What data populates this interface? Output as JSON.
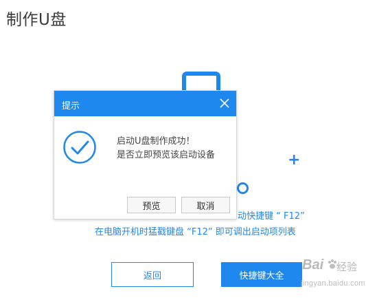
{
  "page": {
    "title": "制作U盘"
  },
  "background": {
    "hint_line1": "动快捷键 “ F12”",
    "hint_line2": "在电脑开机时猛戳键盘 “F12” 即可调出启动项列表",
    "back_label": "返回",
    "shortcut_label": "快捷键大全"
  },
  "dialog": {
    "title": "提示",
    "message_line1": "启动U盘制作成功！",
    "message_line2": "是否立即预览该启动设备",
    "preview_label": "预览",
    "cancel_label": "取消"
  },
  "watermark": {
    "logo": "Bai",
    "text": "经验",
    "url": "jingyan.baidu.com"
  },
  "colors": {
    "accent": "#1e88ee",
    "title_text": "#3a3a3a"
  },
  "icons": [
    "usb-icon",
    "plus-icon",
    "ring-icon",
    "close-icon",
    "check-circle-icon",
    "paw-icon"
  ]
}
